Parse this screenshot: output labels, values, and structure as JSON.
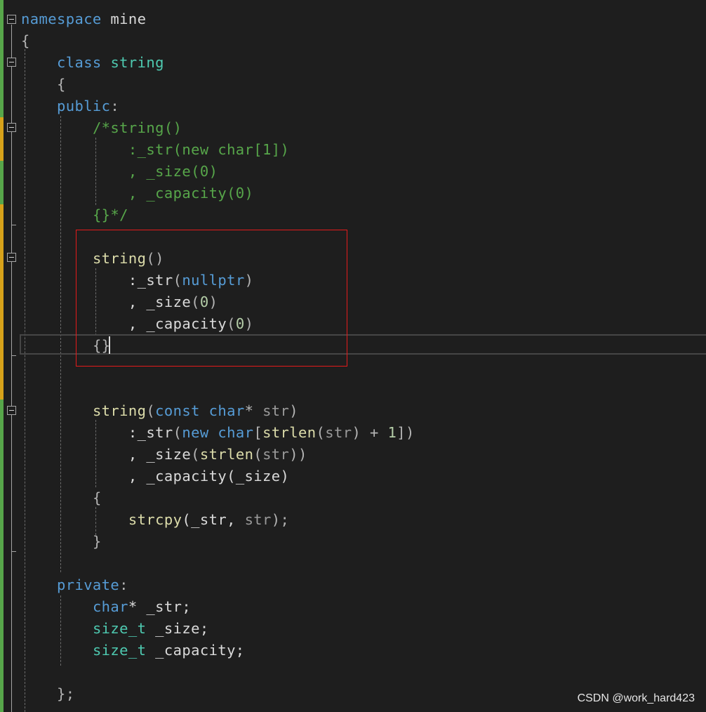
{
  "colors": {
    "background": "#1e1e1e",
    "keyword": "#569cd6",
    "type": "#4ec9b0",
    "function": "#dcdcaa",
    "comment": "#57a64a",
    "identifier": "#dadada",
    "parameter": "#9a9a9a",
    "number": "#b5cea8",
    "punctuation": "#b4b4b4",
    "highlight_box": "#e51b1b",
    "change_saved": "#57a64a",
    "change_unsaved": "#d7a21a"
  },
  "watermark": "CSDN @work_hard423",
  "lines": [
    [
      {
        "t": "namespace",
        "c": "keyword"
      },
      {
        "t": " mine",
        "c": "identifier"
      }
    ],
    [
      {
        "t": "{",
        "c": "punctuation"
      }
    ],
    [
      {
        "t": "    "
      },
      {
        "t": "class",
        "c": "keyword"
      },
      {
        "t": " "
      },
      {
        "t": "string",
        "c": "type"
      }
    ],
    [
      {
        "t": "    "
      },
      {
        "t": "{",
        "c": "punctuation"
      }
    ],
    [
      {
        "t": "    "
      },
      {
        "t": "public",
        "c": "keyword"
      },
      {
        "t": ":",
        "c": "punctuation"
      }
    ],
    [
      {
        "t": "        "
      },
      {
        "t": "/*string()",
        "c": "comment"
      }
    ],
    [
      {
        "t": "            "
      },
      {
        "t": ":_str(new char[1])",
        "c": "comment"
      }
    ],
    [
      {
        "t": "            "
      },
      {
        "t": ", _size(0)",
        "c": "comment"
      }
    ],
    [
      {
        "t": "            "
      },
      {
        "t": ", _capacity(0)",
        "c": "comment"
      }
    ],
    [
      {
        "t": "        "
      },
      {
        "t": "{}*/",
        "c": "comment"
      }
    ],
    [],
    [
      {
        "t": "        "
      },
      {
        "t": "string",
        "c": "function"
      },
      {
        "t": "()",
        "c": "punctuation"
      }
    ],
    [
      {
        "t": "            "
      },
      {
        "t": ":_str",
        "c": "identifier"
      },
      {
        "t": "(",
        "c": "punctuation"
      },
      {
        "t": "nullptr",
        "c": "keyword"
      },
      {
        "t": ")",
        "c": "punctuation"
      }
    ],
    [
      {
        "t": "            "
      },
      {
        "t": ", _size",
        "c": "identifier"
      },
      {
        "t": "(",
        "c": "punctuation"
      },
      {
        "t": "0",
        "c": "number"
      },
      {
        "t": ")",
        "c": "punctuation"
      }
    ],
    [
      {
        "t": "            "
      },
      {
        "t": ", _capacity",
        "c": "identifier"
      },
      {
        "t": "(",
        "c": "punctuation"
      },
      {
        "t": "0",
        "c": "number"
      },
      {
        "t": ")",
        "c": "punctuation"
      }
    ],
    [
      {
        "t": "        "
      },
      {
        "t": "{}",
        "c": "punctuation"
      }
    ],
    [],
    [],
    [
      {
        "t": "        "
      },
      {
        "t": "string",
        "c": "function"
      },
      {
        "t": "(",
        "c": "punctuation"
      },
      {
        "t": "const",
        "c": "keyword"
      },
      {
        "t": " "
      },
      {
        "t": "char",
        "c": "keyword"
      },
      {
        "t": "* ",
        "c": "punctuation"
      },
      {
        "t": "str",
        "c": "parameter"
      },
      {
        "t": ")",
        "c": "punctuation"
      }
    ],
    [
      {
        "t": "            "
      },
      {
        "t": ":_str",
        "c": "identifier"
      },
      {
        "t": "(",
        "c": "punctuation"
      },
      {
        "t": "new",
        "c": "keyword"
      },
      {
        "t": " "
      },
      {
        "t": "char",
        "c": "keyword"
      },
      {
        "t": "[",
        "c": "punctuation"
      },
      {
        "t": "strlen",
        "c": "function"
      },
      {
        "t": "(",
        "c": "punctuation"
      },
      {
        "t": "str",
        "c": "parameter"
      },
      {
        "t": ") + ",
        "c": "punctuation"
      },
      {
        "t": "1",
        "c": "number"
      },
      {
        "t": "])",
        "c": "punctuation"
      }
    ],
    [
      {
        "t": "            "
      },
      {
        "t": ", _size",
        "c": "identifier"
      },
      {
        "t": "(",
        "c": "punctuation"
      },
      {
        "t": "strlen",
        "c": "function"
      },
      {
        "t": "(",
        "c": "punctuation"
      },
      {
        "t": "str",
        "c": "parameter"
      },
      {
        "t": "))",
        "c": "punctuation"
      }
    ],
    [
      {
        "t": "            "
      },
      {
        "t": ", _capacity",
        "c": "identifier"
      },
      {
        "t": "(_size)",
        "c": "identifier"
      }
    ],
    [
      {
        "t": "        "
      },
      {
        "t": "{",
        "c": "punctuation"
      }
    ],
    [
      {
        "t": "            "
      },
      {
        "t": "strcpy",
        "c": "function"
      },
      {
        "t": "(_str, ",
        "c": "identifier"
      },
      {
        "t": "str",
        "c": "parameter"
      },
      {
        "t": ");",
        "c": "punctuation"
      }
    ],
    [
      {
        "t": "        "
      },
      {
        "t": "}",
        "c": "punctuation"
      }
    ],
    [],
    [
      {
        "t": "    "
      },
      {
        "t": "private",
        "c": "keyword"
      },
      {
        "t": ":",
        "c": "punctuation"
      }
    ],
    [
      {
        "t": "        "
      },
      {
        "t": "char",
        "c": "keyword"
      },
      {
        "t": "* _str;",
        "c": "identifier"
      }
    ],
    [
      {
        "t": "        "
      },
      {
        "t": "size_t",
        "c": "type"
      },
      {
        "t": " _size;",
        "c": "identifier"
      }
    ],
    [
      {
        "t": "        "
      },
      {
        "t": "size_t",
        "c": "type"
      },
      {
        "t": " _capacity;",
        "c": "identifier"
      }
    ],
    [],
    [
      {
        "t": "    "
      },
      {
        "t": "};",
        "c": "punctuation"
      }
    ]
  ]
}
